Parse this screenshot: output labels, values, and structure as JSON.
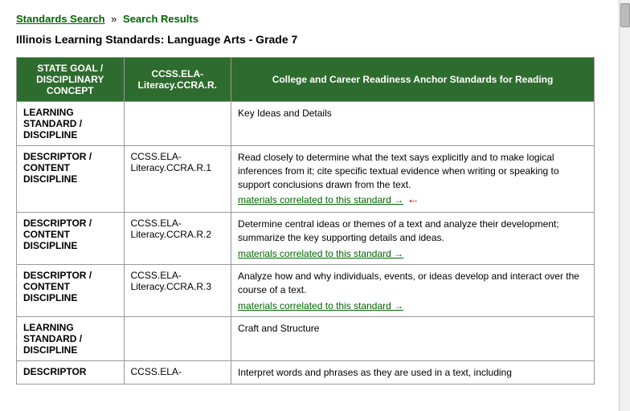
{
  "breadcrumb": {
    "link_label": "Standards Search",
    "separator": "»",
    "current_label": "Search Results"
  },
  "page_title": "Illinois Learning Standards: Language Arts - Grade 7",
  "table": {
    "headers": [
      "STATE GOAL / DISCIPLINARY CONCEPT",
      "CCSS.ELA-Literacy.CCRA.R.",
      "College and Career Readiness Anchor Standards for Reading"
    ],
    "rows": [
      {
        "type": "learning-standard",
        "col1": "LEARNING STANDARD / DISCIPLINE",
        "col2": "",
        "col3": "Key Ideas and Details",
        "col3_link": null,
        "has_arrow": false
      },
      {
        "type": "descriptor",
        "col1": "DESCRIPTOR / CONTENT DISCIPLINE",
        "col2": "CCSS.ELA-Literacy.CCRA.R.1",
        "col3": "Read closely to determine what the text says explicitly and to make logical inferences from it; cite specific textual evidence when writing or speaking to support conclusions drawn from the text.",
        "col3_link": "materials correlated to this standard →",
        "has_arrow": true
      },
      {
        "type": "descriptor",
        "col1": "DESCRIPTOR / CONTENT DISCIPLINE",
        "col2": "CCSS.ELA-Literacy.CCRA.R.2",
        "col3": "Determine central ideas or themes of a text and analyze their development; summarize the key supporting details and ideas.",
        "col3_link": "materials correlated to this standard →",
        "has_arrow": false
      },
      {
        "type": "descriptor",
        "col1": "DESCRIPTOR / CONTENT DISCIPLINE",
        "col2": "CCSS.ELA-Literacy.CCRA.R.3",
        "col3": "Analyze how and why individuals, events, or ideas develop and interact over the course of a text.",
        "col3_link": "materials correlated to this standard →",
        "has_arrow": false
      },
      {
        "type": "learning-standard",
        "col1": "LEARNING STANDARD / DISCIPLINE",
        "col2": "",
        "col3": "Craft and Structure",
        "col3_link": null,
        "has_arrow": false
      },
      {
        "type": "descriptor",
        "col1": "DESCRIPTOR",
        "col2": "CCSS.ELA-",
        "col3": "Interpret words and phrases as they are used in a text, including",
        "col3_link": null,
        "has_arrow": false
      }
    ]
  }
}
